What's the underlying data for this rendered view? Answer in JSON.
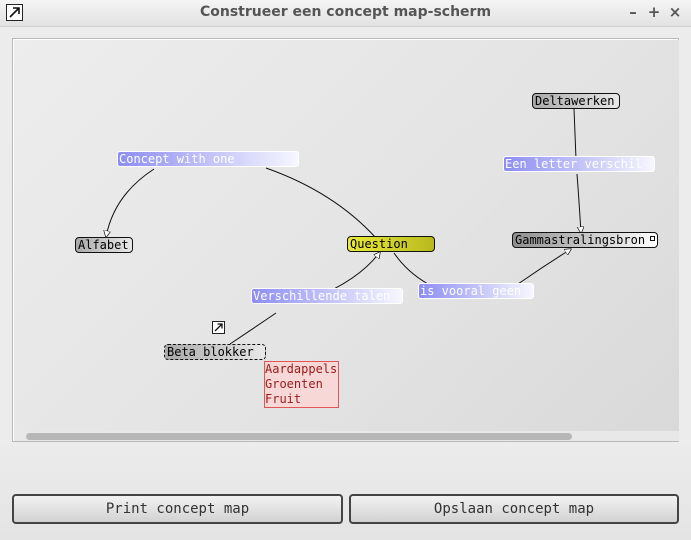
{
  "window": {
    "title": "Construeer een concept map-scherm",
    "controls": {
      "minimize": "–",
      "maximize": "+",
      "close": "×"
    }
  },
  "concept_map": {
    "concepts": {
      "alfabet": "Alfabet",
      "question": "Question",
      "deltawerken": "Deltawerken",
      "gammastralingsbron": "Gammastralingsbron",
      "beta_blokker": "Beta blokker"
    },
    "links": {
      "concept_with_one": "Concept with one",
      "een_letter_verschil": "Een letter verschil",
      "verschillende_talen": "Verschillende talen",
      "is_vooral_geen": "is vooral geen"
    },
    "note_lines": [
      "Aardappels",
      "Groenten",
      "Fruit"
    ]
  },
  "buttons": {
    "print": "Print concept map",
    "save": "Opslaan concept map"
  },
  "colors": {
    "question_fill": "#d6d62e",
    "link_fill": "#9a9af4",
    "note_border": "#e05555"
  }
}
